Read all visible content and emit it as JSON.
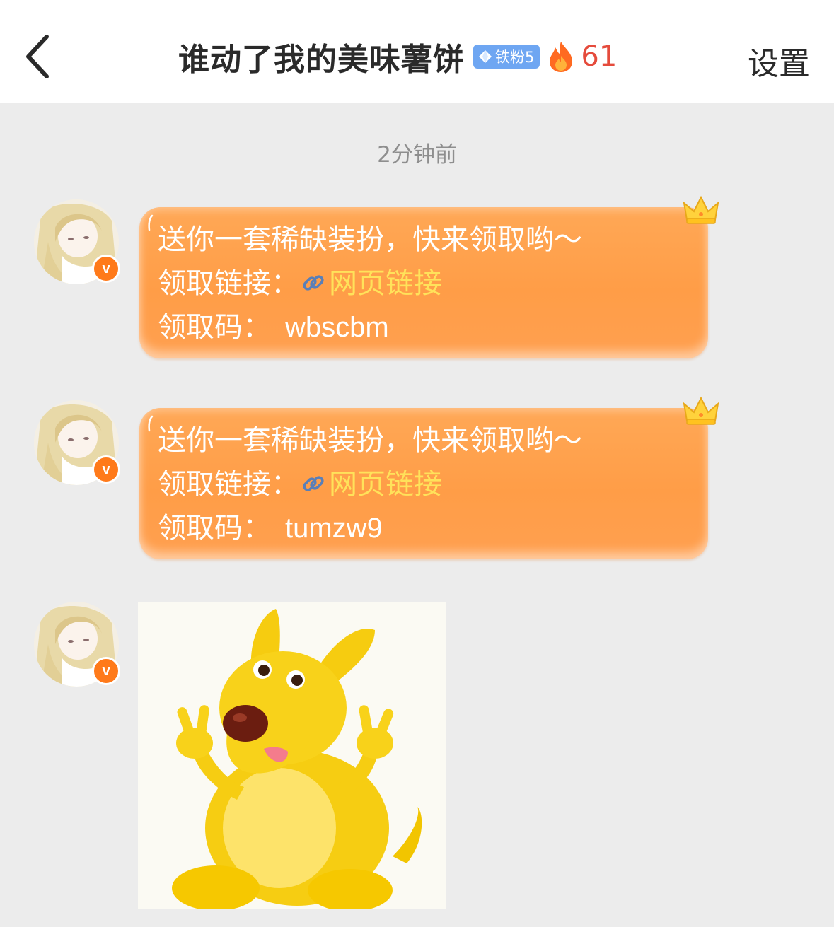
{
  "header": {
    "title": "谁动了我的美味薯饼",
    "fan_badge": "铁粉5",
    "fire_count": "61",
    "settings_label": "设置"
  },
  "chat": {
    "timestamp": "2分钟前",
    "messages": [
      {
        "line1": "送你一套稀缺装扮，快来领取哟～",
        "link_label": "领取链接：",
        "link_text": "网页链接",
        "code_label": "领取码：",
        "code": "wbscbm"
      },
      {
        "line1": "送你一套稀缺装扮，快来领取哟～",
        "link_label": "领取链接：",
        "link_text": "网页链接",
        "code_label": "领取码：",
        "code": "tumzw9"
      }
    ],
    "verified_badge": "v"
  },
  "colors": {
    "bubble": "#ff9f4a",
    "link": "#ffe25a",
    "fire_count": "#e54b3c",
    "verified": "#ff7a1a",
    "fan_badge": "#6ea6f2"
  },
  "icons": [
    "back-arrow-icon",
    "diamond-icon",
    "fire-icon",
    "link-icon",
    "crown-icon",
    "verified-icon"
  ]
}
